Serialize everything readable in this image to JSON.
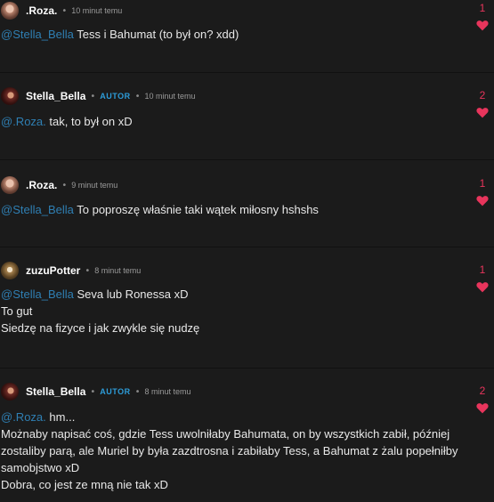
{
  "comments": [
    {
      "author": ".Roza.",
      "avatar": "roza",
      "badge": "",
      "time": "10 minut temu",
      "votes": "1",
      "mention": "@Stella_Bella",
      "lines": [
        "Tess i Bahumat (to był on? xdd)"
      ]
    },
    {
      "author": "Stella_Bella",
      "avatar": "stella",
      "badge": "AUTOR",
      "time": "10 minut temu",
      "votes": "2",
      "mention": "@.Roza.",
      "lines": [
        "tak, to był on xD"
      ]
    },
    {
      "author": ".Roza.",
      "avatar": "roza",
      "badge": "",
      "time": "9 minut temu",
      "votes": "1",
      "mention": "@Stella_Bella",
      "lines": [
        "To poproszę właśnie taki wątek miłosny hshshs"
      ]
    },
    {
      "author": "zuzuPotter",
      "avatar": "zuzu",
      "badge": "",
      "time": "8 minut temu",
      "votes": "1",
      "mention": "@Stella_Bella",
      "lines": [
        "Seva lub Ronessa xD",
        "To gut",
        "Siedzę na fizyce i jak zwykle się nudzę"
      ]
    },
    {
      "author": "Stella_Bella",
      "avatar": "stella",
      "badge": "AUTOR",
      "time": "8 minut temu",
      "votes": "2",
      "mention": "@.Roza.",
      "lines": [
        "hm...",
        "Możnaby napisać coś, gdzie Tess uwolniłaby Bahumata, on by wszystkich zabił, później zostaliby parą, ale Muriel by była zazdtrosna i zabiłaby Tess, a Bahumat z żalu popełniłby samobjstwo xD",
        "Dobra, co jest ze mną nie tak xD"
      ]
    }
  ],
  "colors": {
    "background": "#1b1b1b",
    "mention": "#2f7fb3",
    "badge": "#2d9cd9",
    "vote": "#e8355c"
  },
  "icons": {
    "vote": "heart-icon",
    "avatar": "avatar-image"
  }
}
